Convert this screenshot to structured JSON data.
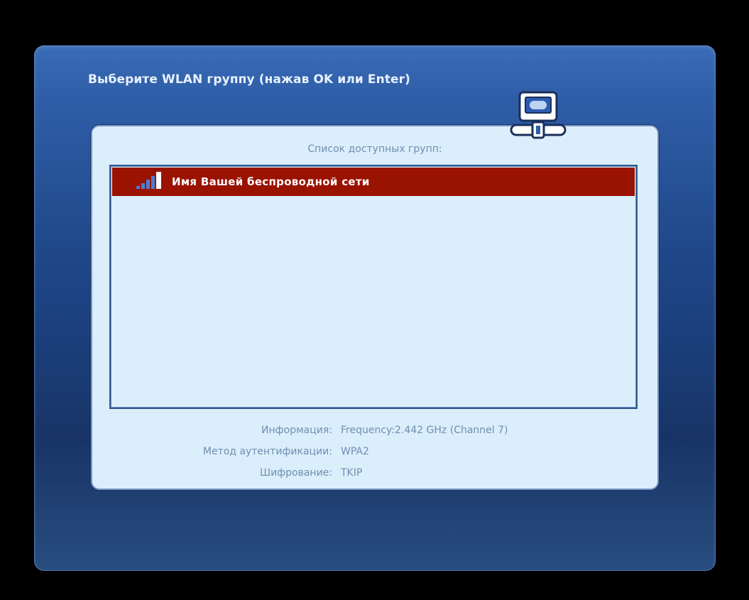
{
  "title": "Выберите WLAN группу (нажав OK или Enter)",
  "panel": {
    "caption": "Список доступных групп:",
    "networks": [
      {
        "name": "Имя Вашей беспроводной сети",
        "selected": true,
        "signal_icon": "signal-strength-icon"
      }
    ],
    "info": {
      "info_label": "Информация:",
      "info_value": "Frequency:2.442 GHz (Channel 7)",
      "auth_label": "Метод аутентификации:",
      "auth_value": "WPA2",
      "encryption_label": "Шифрование:",
      "encryption_value": "TKIP"
    }
  },
  "icons": {
    "network": "network-computer-icon"
  },
  "colors": {
    "selection": "#9a1200",
    "window_bg": "#1f4788",
    "panel_bg": "#dbeefb",
    "secondary_text": "#6f8fb0"
  }
}
